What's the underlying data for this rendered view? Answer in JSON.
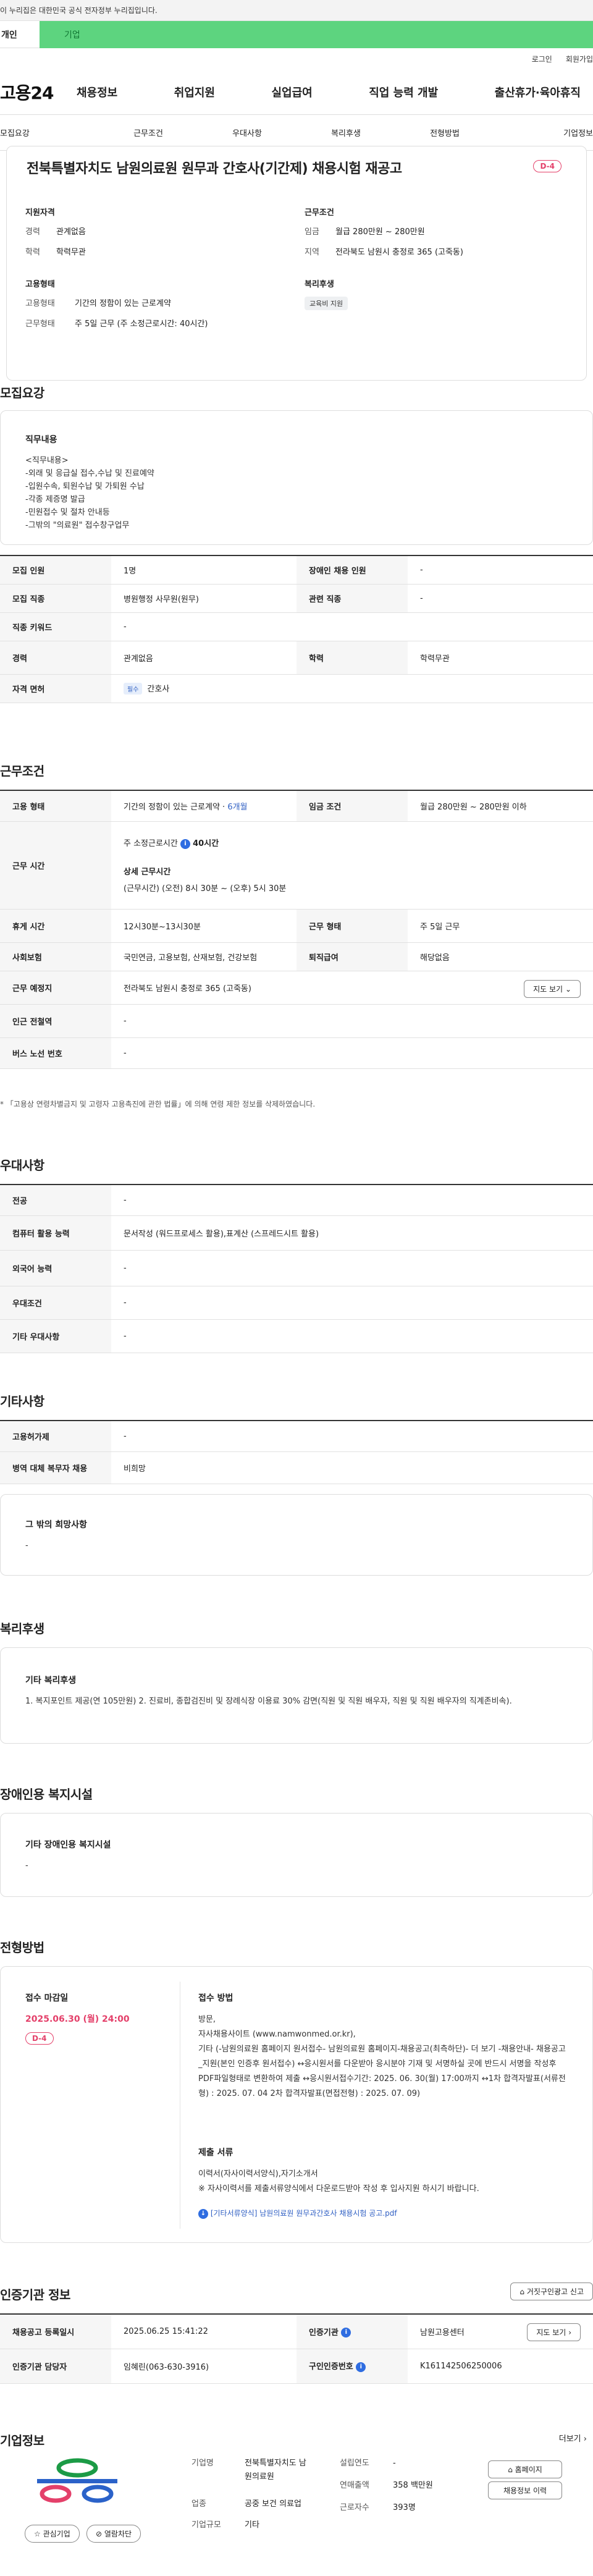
{
  "gov_banner": "이 누리집은 대한민국 공식 전자정부 누리집입니다.",
  "type_tabs": [
    "개인",
    "기업"
  ],
  "util": [
    "로그인",
    "회원가입"
  ],
  "logo": "고용24",
  "gnb": [
    "채용정보",
    "취업지원",
    "실업급여",
    "직업 능력 개발",
    "출산휴가·육아휴직"
  ],
  "sub_tabs": [
    "모집요강",
    "근무조건",
    "우대사항",
    "복리후생",
    "전형방법",
    "기업정보"
  ],
  "job": {
    "title": "전북특별자치도 남원의료원 원무과 간호사(기간제) 채용시험 재공고",
    "dday": "D-4",
    "qual_title": "지원자격",
    "qual": [
      {
        "k": "경력",
        "v": "관계없음"
      },
      {
        "k": "학력",
        "v": "학력무관"
      }
    ],
    "emp_title": "고용형태",
    "emp": [
      {
        "k": "고용형태",
        "v": "기간의 정함이 있는 근로계약"
      },
      {
        "k": "근무형태",
        "v": "주 5일 근무 (주 소정근로시간: 40시간)"
      }
    ],
    "cond_title": "근무조건",
    "cond": [
      {
        "k": "임금",
        "v": "월급 280만원 ~ 280만원"
      },
      {
        "k": "지역",
        "v": "전라북도 남원시 충정로 365 (고죽동)"
      }
    ],
    "welfare_title": "복리후생",
    "welfare_pill": "교육비 지원"
  },
  "recruit": {
    "title": "모집요강",
    "content_label": "직무내용",
    "content_text": "<직무내용>\n-외래 및 응급실 접수,수납 및 진료예약\n-입원수속, 퇴원수납 및 가퇴원 수납\n-각종 제증명 발급\n-민원접수 및 절차 안내등\n-그밖의 \"의료원\" 접수창구업무",
    "rows": [
      [
        "모집 인원",
        "1명",
        "장애인 채용 인원",
        "-"
      ],
      [
        "모집 직종",
        "병원행정 사무원(원무)",
        "관련 직종",
        "-"
      ],
      [
        "직종 키워드",
        "-",
        "",
        ""
      ],
      [
        "경력",
        "관계없음",
        "학력",
        "학력무관"
      ]
    ],
    "license_label": "자격 면허",
    "license_badge": "필수",
    "license_value": "간호사"
  },
  "work": {
    "title": "근무조건",
    "emp_type_label": "고용 형태",
    "emp_type_value": "기간의 정함이 있는 근로계약 · ",
    "emp_type_period": "6개월",
    "wage_label": "임금 조건",
    "wage_value": "월급 280만원 ~ 280만원 이하",
    "hours_label": "근무 시간",
    "hours_week": "주 소정근로시간",
    "hours_week_value": "40시간",
    "hours_detail_title": "상세 근무시간",
    "hours_detail": "(근무시간) (오전) 8시 30분 ~ (오후) 5시 30분",
    "break_label": "휴게 시간",
    "break_value": "12시30분~13시30분",
    "shift_label": "근무 형태",
    "shift_value": "주 5일 근무",
    "insurance_label": "사회보험",
    "insurance_value": "국민연금, 고용보험, 산재보험, 건강보험",
    "retire_label": "퇴직급여",
    "retire_value": "해당없음",
    "place_label": "근무 예정지",
    "place_value": "전라북도 남원시 충정로 365 (고죽동)",
    "map_btn": "지도 보기",
    "station_label": "인근 전철역",
    "station_value": "-",
    "bus_label": "버스 노선 번호",
    "bus_value": "-",
    "note": "* 「고용상 연령차별금지 및 고령자 고용촉진에 관한 법률」에 의해 연령 제한 정보를 삭제하였습니다."
  },
  "pref": {
    "title": "우대사항",
    "rows": [
      [
        "전공",
        "-"
      ],
      [
        "컴퓨터 활용 능력",
        "문서작성 (워드프로세스 활용),표계산 (스프레드시트 활용)"
      ],
      [
        "외국어 능력",
        "-"
      ],
      [
        "우대조건",
        "-"
      ],
      [
        "기타 우대사항",
        "-"
      ]
    ]
  },
  "etc": {
    "title": "기타사항",
    "rows": [
      [
        "고용허가제",
        "-"
      ],
      [
        "병역 대체 복무자 채용",
        "비희망"
      ]
    ],
    "other_label": "그 밖의 희망사항",
    "other_value": "-"
  },
  "welfare": {
    "title": "복리후생",
    "label": "기타 복리후생",
    "text": "1. 복지포인트 제공(연 105만원) 2. 진료비, 종합검진비 및 장례식장 이용료 30% 감면(직원 및 직원 배우자, 직원 및 직원 배우자의 직계존비속)."
  },
  "disabled": {
    "title": "장애인용 복지시설",
    "label": "기타 장애인용 복지시설",
    "value": "-"
  },
  "selection": {
    "title": "전형방법",
    "deadline_label": "접수 마감일",
    "deadline": "2025.06.30 (월) 24:00",
    "dday": "D-4",
    "method_label": "접수 방법",
    "method_text": "방문,\n자사채용사이트 (www.namwonmed.or.kr),\n기타 (-남원의료원 홈페이지 원서접수- 남원의료원 홈페이지-채용공고(최측하단)- 더 보기 -채용안내- 채용공고_지원(본인 인증후 원서접수) ↔응시원서를 다운받아 응시분야 기재 및 서명하실 곳에 반드시 서명을 작성후 PDF파일형태로 변환하여 제출 ↔응시원서접수기간: 2025. 06. 30(월) 17:00까지 ↔1차 합격자발표(서류전형) : 2025. 07. 04    2차 합격자발표(면접전형) : 2025. 07. 09)",
    "docs_label": "제출 서류",
    "docs_text": "이력서(자사이력서양식),자기소개서\n※ 자사이력서를 제출서류양식에서 다운로드받아 작성 후 입사지원 하시기 바랍니다.",
    "file_link": "[기타서류양식] 남원의료원 원무과간호사 채용시험 공고.pdf"
  },
  "cert": {
    "title": "인증기관 정보",
    "report_btn": "거짓구인광고 신고",
    "reg_date_label": "채용공고 등록일시",
    "reg_date": "2025.06.25 15:41:22",
    "agency_label": "인증기관",
    "agency": "남원고용센터",
    "map_btn": "지도 보기",
    "manager_label": "인증기관 담당자",
    "manager": "임혜린(063-630-3916)",
    "auth_label": "구인인증번호",
    "auth_no": "K161142506250006"
  },
  "company": {
    "title": "기업정보",
    "more": "더보기",
    "fav_btn": "관심기업",
    "follow_btn": "열람차단",
    "rows": [
      {
        "k": "기업명",
        "v": "전북특별자치도 남원의료원"
      },
      {
        "k": "업종",
        "v": "공중 보건 의료업"
      },
      {
        "k": "기업규모",
        "v": "기타"
      }
    ],
    "rows2": [
      {
        "k": "설립연도",
        "v": "-"
      },
      {
        "k": "연매출액",
        "v": "358 백만원"
      },
      {
        "k": "근로자수",
        "v": "393명"
      }
    ],
    "home_btn": "홈페이지",
    "jobs_btn": "채용정보 이력"
  },
  "colors": {
    "accent_green": "#5dd47f",
    "dday_pink": "#e4406a",
    "link_blue": "#2f5fc3"
  }
}
